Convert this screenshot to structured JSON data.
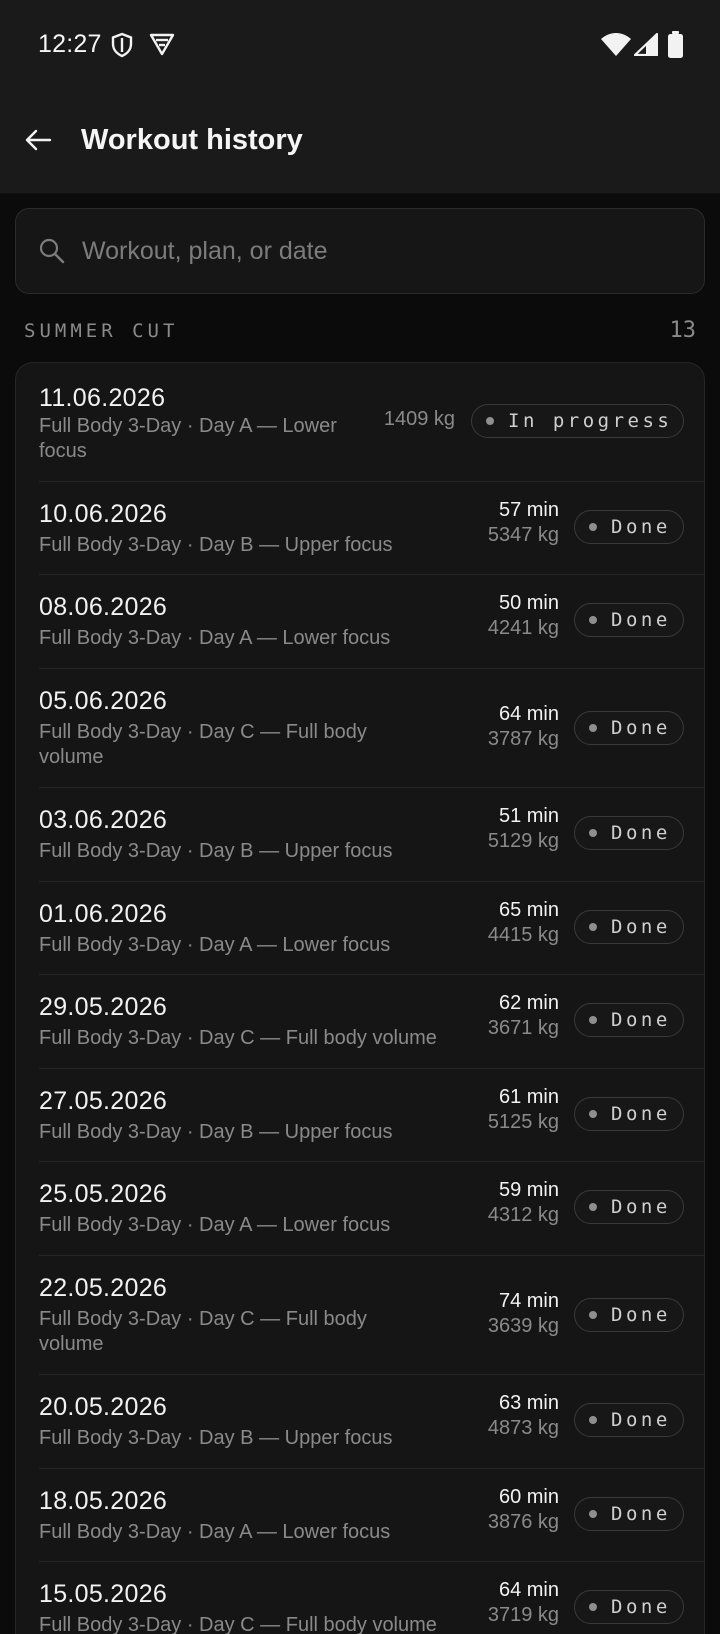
{
  "status_bar": {
    "time": "12:27"
  },
  "app_bar": {
    "title": "Workout history"
  },
  "search": {
    "placeholder": "Workout, plan, or date",
    "value": ""
  },
  "section": {
    "title": "SUMMER CUT",
    "count": "13"
  },
  "workouts": [
    {
      "date": "11.06.2026",
      "plan": "Full Body 3-Day · Day A — Lower focus",
      "duration": "",
      "volume": "1409 kg",
      "status": "In progress"
    },
    {
      "date": "10.06.2026",
      "plan": "Full Body 3-Day · Day B — Upper focus",
      "duration": "57 min",
      "volume": "5347 kg",
      "status": "Done"
    },
    {
      "date": "08.06.2026",
      "plan": "Full Body 3-Day · Day A — Lower focus",
      "duration": "50 min",
      "volume": "4241 kg",
      "status": "Done"
    },
    {
      "date": "05.06.2026",
      "plan": "Full Body 3-Day · Day C — Full body volume",
      "duration": "64 min",
      "volume": "3787 kg",
      "status": "Done"
    },
    {
      "date": "03.06.2026",
      "plan": "Full Body 3-Day · Day B — Upper focus",
      "duration": "51 min",
      "volume": "5129 kg",
      "status": "Done"
    },
    {
      "date": "01.06.2026",
      "plan": "Full Body 3-Day · Day A — Lower focus",
      "duration": "65 min",
      "volume": "4415 kg",
      "status": "Done"
    },
    {
      "date": "29.05.2026",
      "plan": "Full Body 3-Day · Day C — Full body volume",
      "duration": "62 min",
      "volume": "3671 kg",
      "status": "Done"
    },
    {
      "date": "27.05.2026",
      "plan": "Full Body 3-Day · Day B — Upper focus",
      "duration": "61 min",
      "volume": "5125 kg",
      "status": "Done"
    },
    {
      "date": "25.05.2026",
      "plan": "Full Body 3-Day · Day A — Lower focus",
      "duration": "59 min",
      "volume": "4312 kg",
      "status": "Done"
    },
    {
      "date": "22.05.2026",
      "plan": "Full Body 3-Day · Day C — Full body volume",
      "duration": "74 min",
      "volume": "3639 kg",
      "status": "Done"
    },
    {
      "date": "20.05.2026",
      "plan": "Full Body 3-Day · Day B — Upper focus",
      "duration": "63 min",
      "volume": "4873 kg",
      "status": "Done"
    },
    {
      "date": "18.05.2026",
      "plan": "Full Body 3-Day · Day A — Lower focus",
      "duration": "60 min",
      "volume": "3876 kg",
      "status": "Done"
    },
    {
      "date": "15.05.2026",
      "plan": "Full Body 3-Day · Day C — Full body volume",
      "duration": "64 min",
      "volume": "3719 kg",
      "status": "Done"
    }
  ]
}
